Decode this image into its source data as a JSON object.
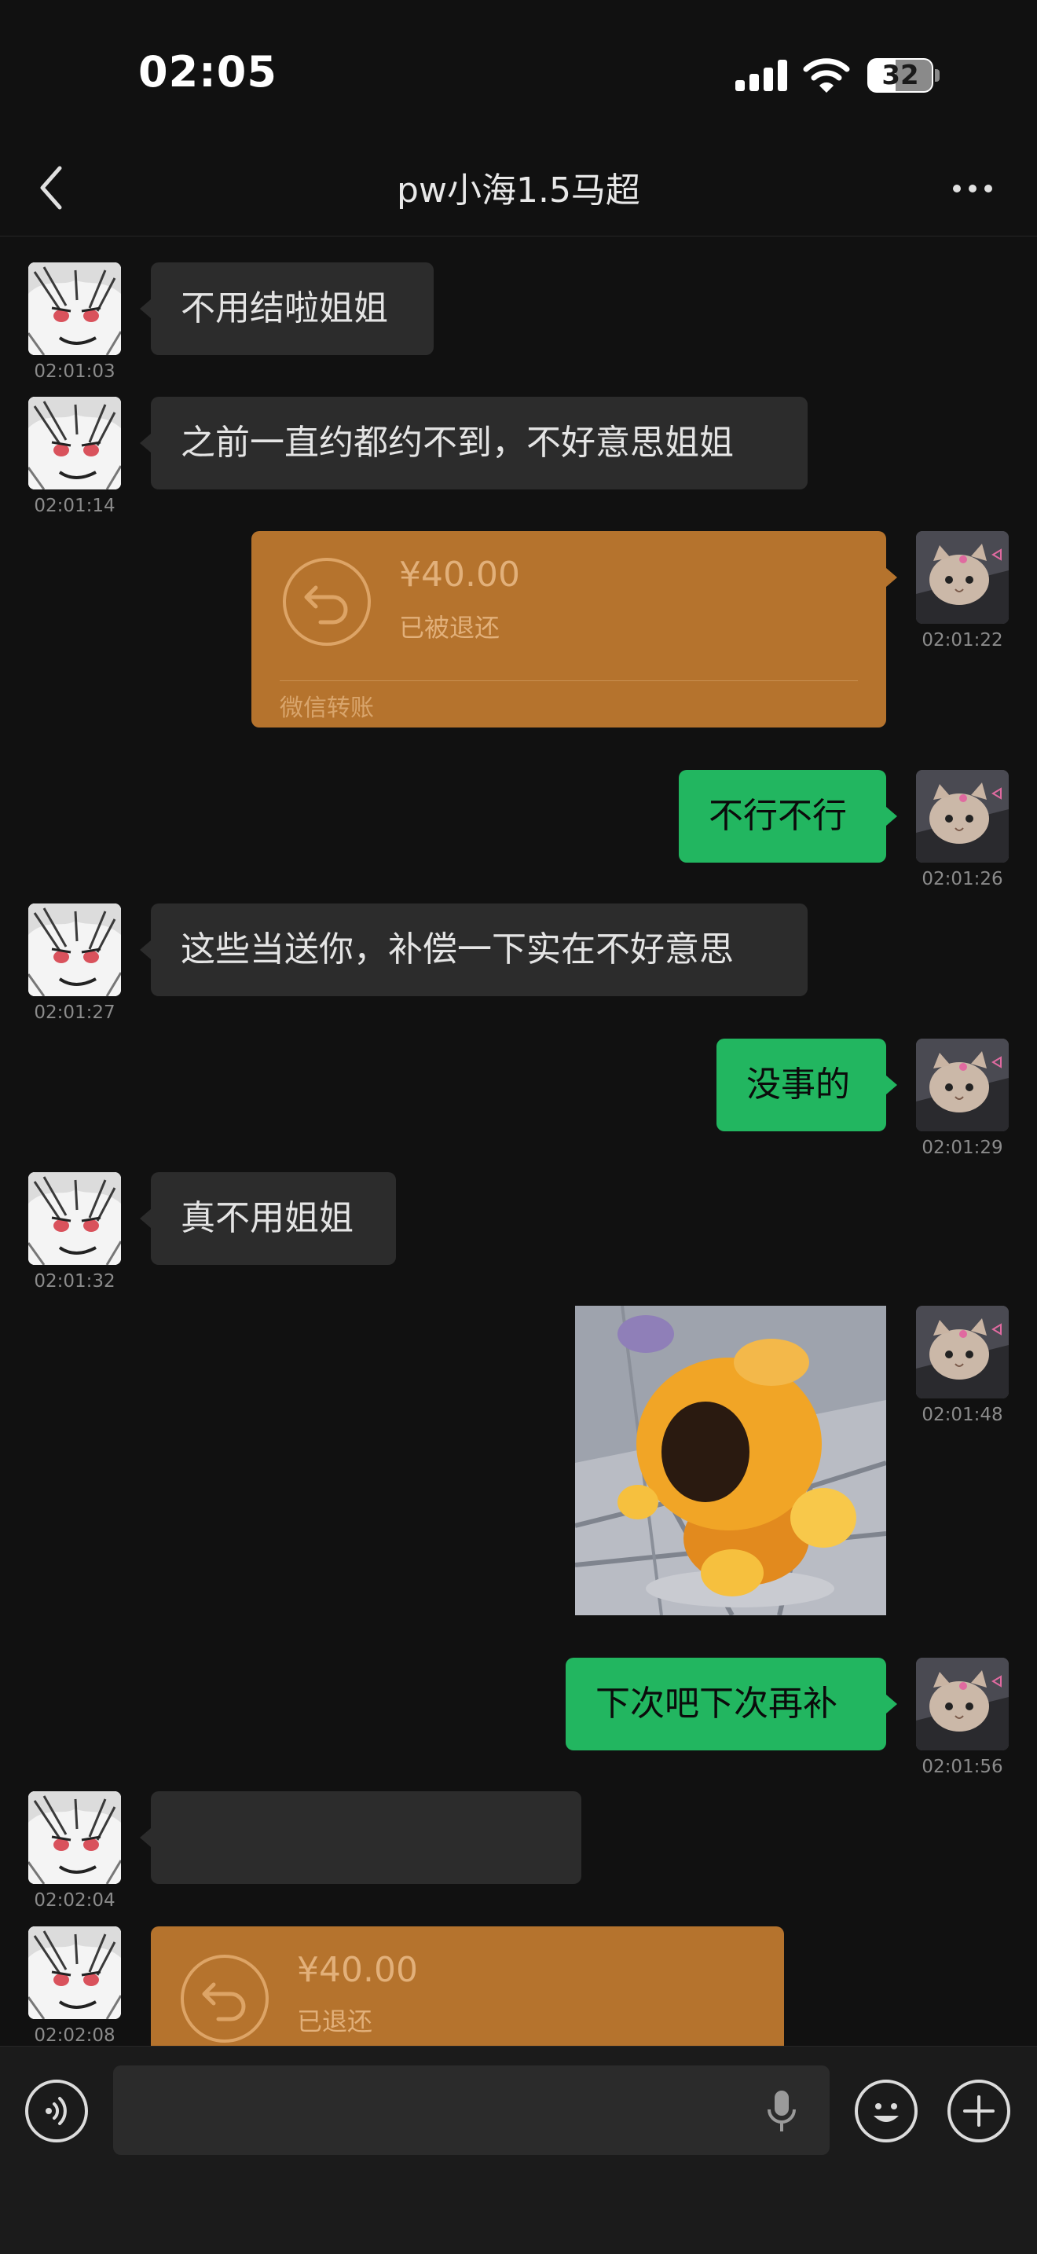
{
  "status_bar": {
    "time": "02:05",
    "battery": "32"
  },
  "nav": {
    "title": "pw小海1.5马超"
  },
  "messages": {
    "m1": {
      "text": "不用结啦姐姐",
      "time": "02:01:03"
    },
    "m2": {
      "text": "之前一直约都约不到，不好意思姐姐",
      "time": "02:01:14"
    },
    "m3": {
      "amount": "¥40.00",
      "status": "已被退还",
      "label": "微信转账",
      "time": "02:01:22"
    },
    "m4": {
      "text": "不行不行",
      "time": "02:01:26"
    },
    "m5": {
      "text": "这些当送你，补偿一下实在不好意思",
      "time": "02:01:27"
    },
    "m6": {
      "text": "没事的",
      "time": "02:01:29"
    },
    "m7": {
      "text": "真不用姐姐",
      "time": "02:01:32"
    },
    "m8": {
      "time": "02:01:48"
    },
    "m9": {
      "text": "下次吧下次再补",
      "time": "02:01:56"
    },
    "m10": {
      "text": "",
      "time": "02:02:04"
    },
    "m11": {
      "amount": "¥40.00",
      "status": "已退还",
      "time": "02:02:08"
    }
  },
  "colors": {
    "background": "#111111",
    "sent_bubble": "#22b660",
    "received_bubble": "#2c2c2c",
    "transfer": "#b5732d"
  }
}
